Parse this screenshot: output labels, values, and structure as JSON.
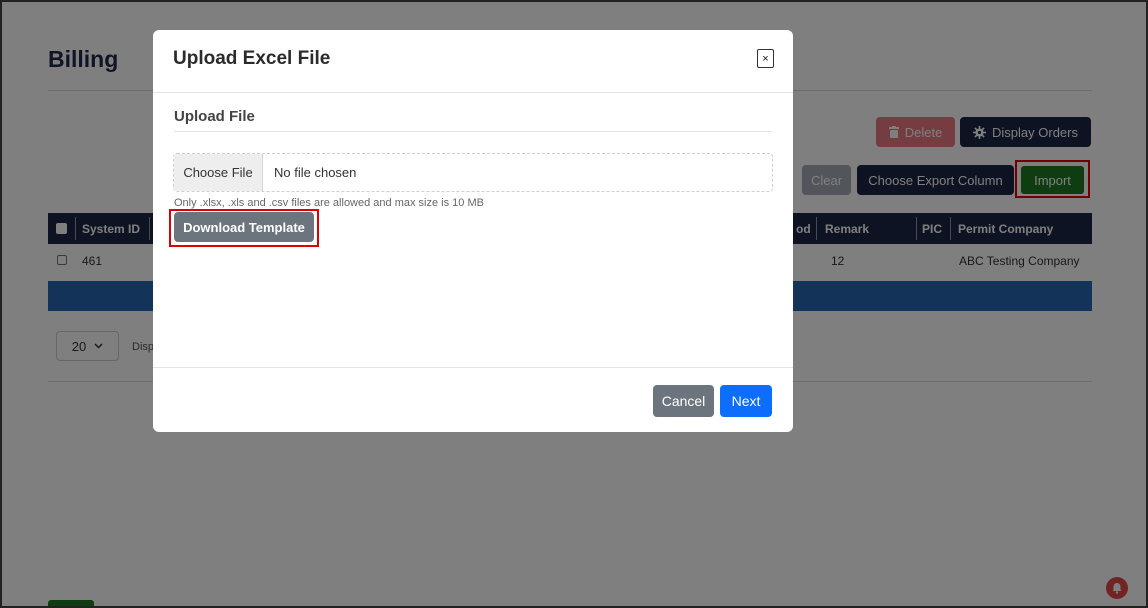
{
  "page": {
    "title": "Billing",
    "toolbar": {
      "delete_label": "Delete",
      "display_orders_label": "Display Orders",
      "clear_label": "Clear",
      "choose_export_label": "Choose Export Column",
      "import_label": "Import"
    },
    "table": {
      "headers": [
        "System ID",
        "od",
        "Remark",
        "PIC",
        "Permit Company"
      ],
      "row": {
        "system_id": "461",
        "remark": "12",
        "permit_company": "ABC Testing Company"
      }
    },
    "pager": {
      "page_size": "20",
      "display_text": "Disp"
    }
  },
  "modal": {
    "title": "Upload Excel File",
    "close_label": "×",
    "section_title": "Upload File",
    "choose_file_label": "Choose File",
    "no_file_text": "No file chosen",
    "help_text": "Only .xlsx, .xls and .csv files are allowed and max size is 10 MB",
    "download_template_label": "Download Template",
    "cancel_label": "Cancel",
    "next_label": "Next"
  },
  "colors": {
    "navy": "#1c2646",
    "import_green": "#1f7a23",
    "highlight_red": "#e00000",
    "next_blue": "#0d6efd",
    "secondary_gray": "#6c757d"
  },
  "icons": {
    "delete": "trash-icon",
    "display_orders": "gear-icon",
    "pager": "chevron-down-icon",
    "notifications": "bell-icon"
  }
}
